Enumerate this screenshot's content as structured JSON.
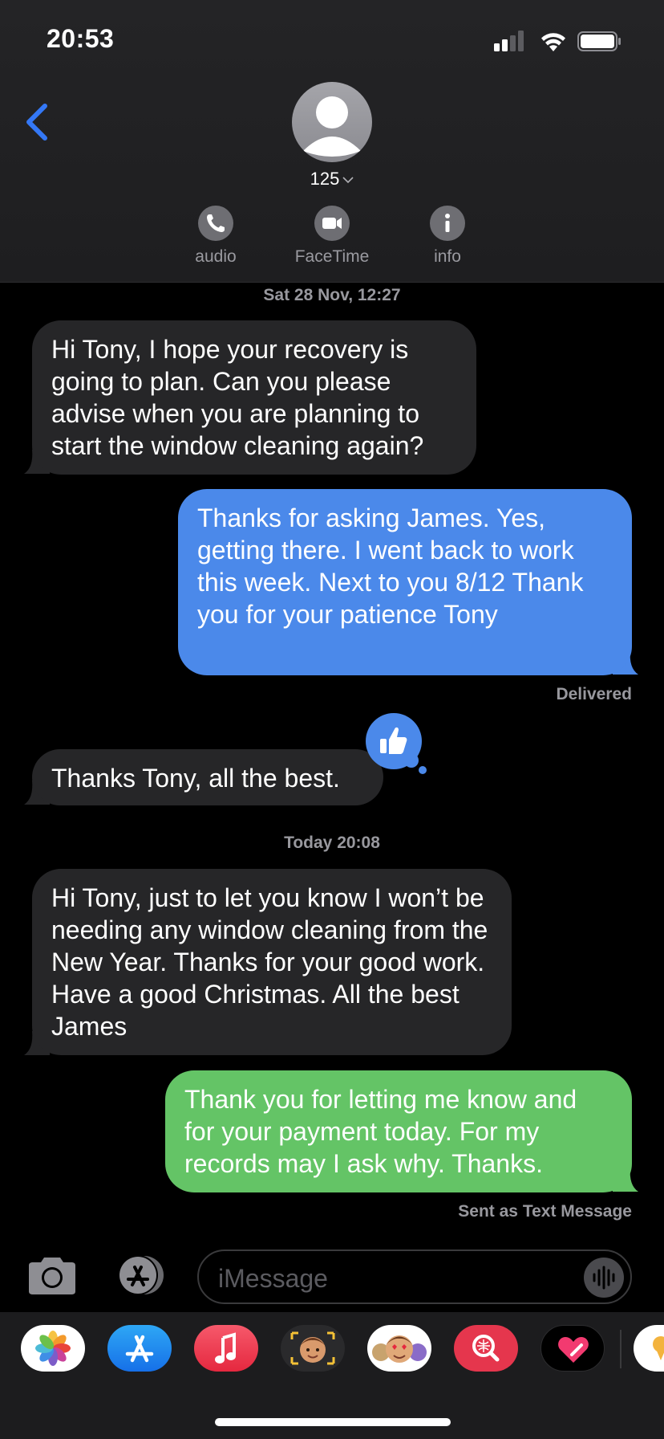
{
  "status_bar": {
    "time": "20:53"
  },
  "header": {
    "contact_name": "125",
    "actions": [
      {
        "label": "audio",
        "icon": "phone-icon"
      },
      {
        "label": "FaceTime",
        "icon": "video-camera-icon"
      },
      {
        "label": "info",
        "icon": "info-icon"
      }
    ]
  },
  "conversation": {
    "timestamp_1": "Sat 28 Nov, 12:27",
    "msg_1": "Hi Tony, I hope your recovery is going to plan. Can you please advise when you are planning to start the window cleaning again?",
    "msg_2": "Thanks for asking James. Yes, getting there. I went back to work this week. Next to you 8/12 Thank you for your patience Tony",
    "msg_2_status": "Delivered",
    "msg_3": "Thanks Tony, all the best.",
    "msg_3_tapback": "thumbs-up-icon",
    "timestamp_2": "Today 20:08",
    "msg_4": "Hi Tony, just to let you know I won’t be needing any window cleaning from the New Year. Thanks for your good work. Have a good Christmas. All the best James",
    "msg_5": "Thank you for letting me know and for your payment today. For my records may I ask why. Thanks.",
    "msg_5_status": "Sent as Text Message"
  },
  "compose": {
    "placeholder": "iMessage"
  },
  "app_drawer": {
    "apps": [
      "photos-app-icon",
      "app-store-icon",
      "music-app-icon",
      "memoji-app-icon",
      "animoji-app-icon",
      "search-images-icon",
      "digital-touch-icon"
    ]
  },
  "colors": {
    "imessage_blue": "#4b89ea",
    "sms_green": "#64c466",
    "incoming_bubble": "#262628",
    "accent_back": "#3478f6"
  }
}
